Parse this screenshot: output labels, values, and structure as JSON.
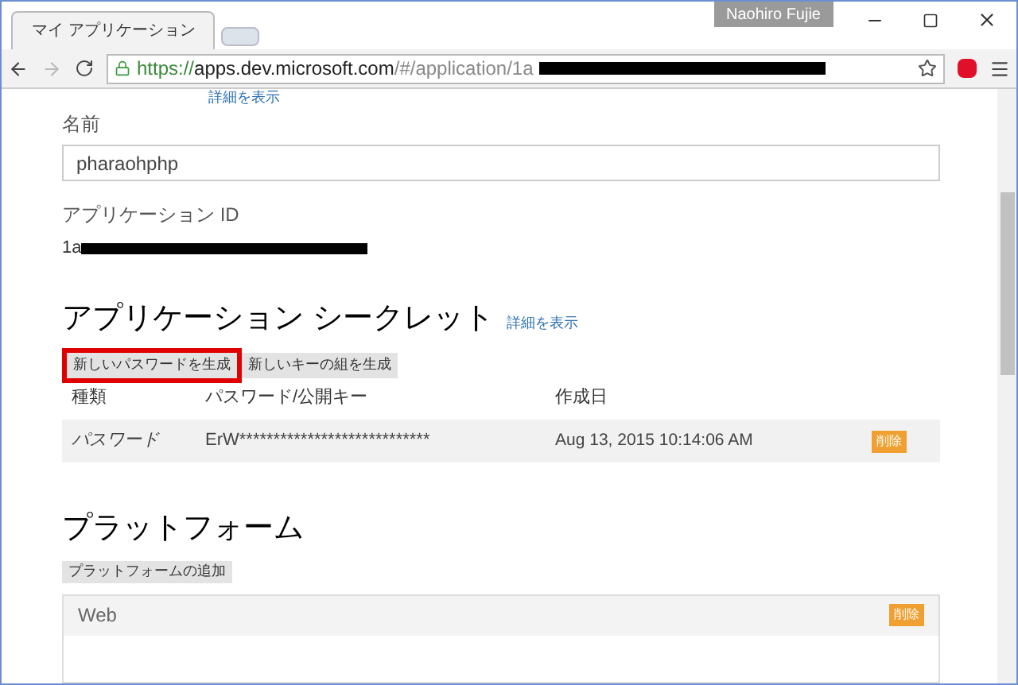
{
  "browser": {
    "tab_title": "マイ アプリケーション",
    "profile": "Naohiro Fujie",
    "url_scheme": "https://",
    "url_host": "apps.dev.microsoft.com",
    "url_path": "/#/application/1a"
  },
  "top_link": "詳細を表示",
  "name_field": {
    "label": "名前",
    "value": "pharaohphp"
  },
  "app_id": {
    "label": "アプリケーション ID",
    "value": "1a"
  },
  "secrets": {
    "title": "アプリケーション シークレット",
    "link": "詳細を表示",
    "buttons": [
      {
        "label": "新しいパスワードを生成",
        "highlighted": true
      },
      {
        "label": "新しいキーの組を生成",
        "highlighted": false
      }
    ],
    "columns": [
      "種類",
      "パスワード/公開キー",
      "作成日"
    ],
    "rows": [
      {
        "type": "パスワード",
        "key": "ErW****************************",
        "created": "Aug 13, 2015 10:14:06 AM",
        "action": "削除"
      }
    ]
  },
  "platforms": {
    "title": "プラットフォーム",
    "add_button": "プラットフォームの追加",
    "items": [
      {
        "name": "Web",
        "action": "削除"
      }
    ]
  }
}
